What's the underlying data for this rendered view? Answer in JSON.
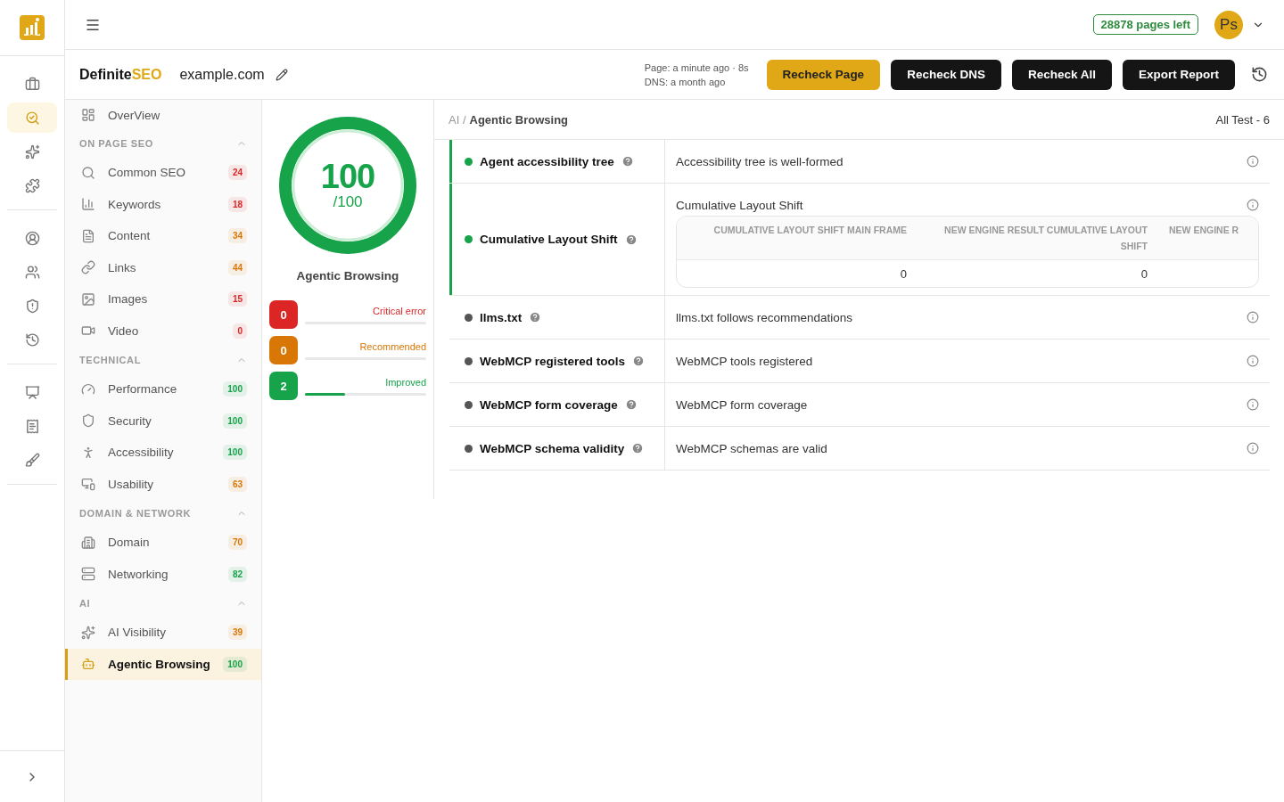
{
  "rail_items": [
    {
      "selected": false
    },
    {
      "selected": true
    },
    {
      "selected": false
    },
    {
      "selected": false
    },
    {
      "selected": false
    },
    {
      "selected": false
    },
    {
      "selected": false
    },
    {
      "selected": false
    },
    {
      "selected": false
    },
    {
      "selected": false
    },
    {
      "selected": false
    }
  ],
  "topbar": {
    "pages_left": "28878 pages left",
    "avatar": "Ps"
  },
  "header": {
    "brand": {
      "main": "Definite",
      "accent": "SEO"
    },
    "domain": "example.com",
    "timestamps": [
      "Page: a minute ago · 8s",
      "DNS: a month ago"
    ],
    "buttons": [
      {
        "label": "Recheck Page",
        "kind": "primary"
      },
      {
        "label": "Recheck DNS",
        "kind": "dark"
      },
      {
        "label": "Recheck All",
        "kind": "dark"
      },
      {
        "label": "Export Report",
        "kind": "dark"
      }
    ]
  },
  "sidebar": {
    "overview": {
      "label": "OverView",
      "selected": false
    },
    "sections": [
      {
        "title": "ON PAGE SEO",
        "expanded": true,
        "items": [
          {
            "label": "Common SEO",
            "count": "24",
            "color": "#dc2626",
            "selected": false
          },
          {
            "label": "Keywords",
            "count": "18",
            "color": "#dc2626",
            "selected": false
          },
          {
            "label": "Content",
            "count": "34",
            "color": "#d97706",
            "selected": false
          },
          {
            "label": "Links",
            "count": "44",
            "color": "#d97706",
            "selected": false
          },
          {
            "label": "Images",
            "count": "15",
            "color": "#dc2626",
            "selected": false
          },
          {
            "label": "Video",
            "count": "0",
            "color": "#dc2626",
            "selected": false
          }
        ]
      },
      {
        "title": "TECHNICAL",
        "expanded": true,
        "items": [
          {
            "label": "Performance",
            "count": "100",
            "color": "#16a34a",
            "selected": false
          },
          {
            "label": "Security",
            "count": "100",
            "color": "#16a34a",
            "selected": false
          },
          {
            "label": "Accessibility",
            "count": "100",
            "color": "#16a34a",
            "selected": false
          },
          {
            "label": "Usability",
            "count": "63",
            "color": "#d97706",
            "selected": false
          }
        ]
      },
      {
        "title": "DOMAIN & NETWORK",
        "expanded": true,
        "items": [
          {
            "label": "Domain",
            "count": "70",
            "color": "#d97706",
            "selected": false
          },
          {
            "label": "Networking",
            "count": "82",
            "color": "#16a34a",
            "selected": false
          }
        ]
      },
      {
        "title": "AI",
        "expanded": true,
        "items": [
          {
            "label": "AI Visibility",
            "count": "39",
            "color": "#d97706",
            "selected": false
          },
          {
            "label": "Agentic Browsing",
            "count": "100",
            "color": "#16a34a",
            "selected": true
          }
        ]
      }
    ]
  },
  "score": {
    "value": "100",
    "out_of": "/100",
    "title": "Agentic Browsing",
    "counts": [
      {
        "count": "0",
        "label": "Critical error",
        "color": "#dc2626"
      },
      {
        "count": "0",
        "label": "Recommended",
        "color": "#d97706"
      },
      {
        "count": "2",
        "label": "Improved",
        "color": "#16a34a",
        "level": 0.33
      }
    ]
  },
  "breadcrumb": {
    "parent": "AI /",
    "current": "Agentic Browsing",
    "total": "All Test - 6"
  },
  "tests": [
    {
      "name": "Agent accessibility tree",
      "passed": true,
      "result": "Accessibility tree is well-formed"
    },
    {
      "name": "Cumulative Layout Shift",
      "passed": true,
      "result": "Cumulative Layout Shift",
      "table": {
        "columns": [
          "CUMULATIVE LAYOUT SHIFT MAIN FRAME",
          "NEW ENGINE RESULT CUMULATIVE LAYOUT SHIFT",
          "NEW ENGINE R"
        ],
        "rows": [
          [
            "0",
            "0"
          ]
        ]
      }
    },
    {
      "name": "llms.txt",
      "passed": false,
      "result": "llms.txt follows recommendations"
    },
    {
      "name": "WebMCP registered tools",
      "passed": false,
      "result": "WebMCP tools registered"
    },
    {
      "name": "WebMCP form coverage",
      "passed": false,
      "result": "WebMCP form coverage"
    },
    {
      "name": "WebMCP schema validity",
      "passed": false,
      "result": "WebMCP schemas are valid"
    }
  ]
}
